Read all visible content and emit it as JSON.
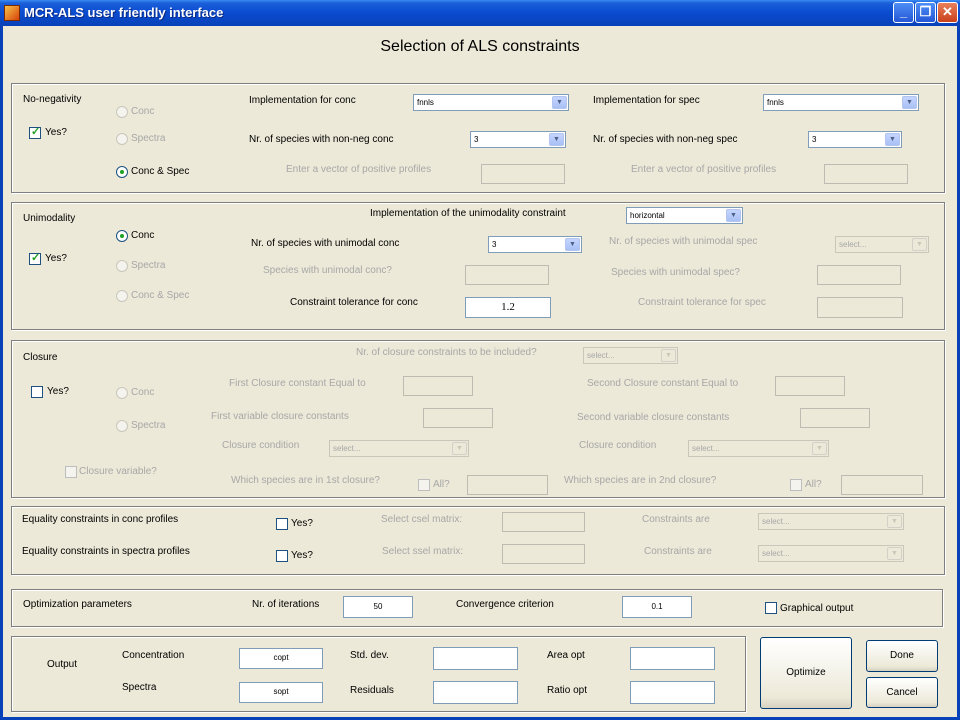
{
  "window": {
    "title": "MCR-ALS user friendly interface",
    "min_glyph": "_",
    "max_glyph": "❐",
    "close_glyph": "✕"
  },
  "page_title": "Selection of ALS constraints",
  "nonneg": {
    "title": "No-negativity",
    "yes": "Yes?",
    "opt_conc": "Conc",
    "opt_spectra": "Spectra",
    "opt_both": "Conc & Spec",
    "impl_conc_label": "Implementation for conc",
    "impl_conc_value": "fnnls",
    "impl_spec_label": "Implementation for spec",
    "impl_spec_value": "fnnls",
    "nr_conc_label": "Nr. of species with non-neg conc",
    "nr_conc_value": "3",
    "nr_spec_label": "Nr. of species with non-neg spec",
    "nr_spec_value": "3",
    "vec_conc_label": "Enter a vector of positive profiles",
    "vec_spec_label": "Enter a vector of positive profiles"
  },
  "unimod": {
    "title": "Unimodality",
    "yes": "Yes?",
    "opt_conc": "Conc",
    "opt_spectra": "Spectra",
    "opt_both": "Conc & Spec",
    "impl_label": "Implementation of the unimodality constraint",
    "impl_value": "horizontal",
    "nr_conc_label": "Nr. of species with unimodal conc",
    "nr_conc_value": "3",
    "nr_spec_label": "Nr. of species with unimodal spec",
    "nr_spec_value": "select...",
    "sp_conc_label": "Species with unimodal conc?",
    "sp_spec_label": "Species with unimodal spec?",
    "tol_conc_label": "Constraint tolerance for conc",
    "tol_conc_value": "1.2",
    "tol_spec_label": "Constraint tolerance for spec"
  },
  "closure": {
    "title": "Closure",
    "yes": "Yes?",
    "opt_conc": "Conc",
    "opt_spectra": "Spectra",
    "nr_label": "Nr. of closure constraints to be included?",
    "nr_value": "select...",
    "first_eq_label": "First Closure constant Equal to",
    "second_eq_label": "Second Closure constant Equal to",
    "first_var_label": "First variable closure constants",
    "second_var_label": "Second variable closure constants",
    "cond1_label": "Closure condition",
    "cond1_value": "select...",
    "cond2_label": "Closure condition",
    "cond2_value": "select...",
    "variable_label": "Closure variable?",
    "which1_label": "Which species are in 1st closure?",
    "which2_label": "Which species are in 2nd closure?",
    "all1": "All?",
    "all2": "All?"
  },
  "equality": {
    "conc_label": "Equality constraints in conc profiles",
    "spec_label": "Equality constraints in spectra profiles",
    "yes1": "Yes?",
    "yes2": "Yes?",
    "csel_label": "Select csel matrix:",
    "ssel_label": "Select ssel matrix:",
    "are1_label": "Constraints are",
    "are1_value": "select...",
    "are2_label": "Constraints are",
    "are2_value": "select..."
  },
  "optim": {
    "title": "Optimization parameters",
    "iter_label": "Nr. of iterations",
    "iter_value": "50",
    "conv_label": "Convergence criterion",
    "conv_value": "0.1",
    "graph_label": "Graphical output"
  },
  "output": {
    "title": "Output",
    "conc_label": "Concentration",
    "conc_value": "copt",
    "spec_label": "Spectra",
    "spec_value": "sopt",
    "std_label": "Std. dev.",
    "res_label": "Residuals",
    "area_label": "Area opt",
    "ratio_label": "Ratio opt"
  },
  "buttons": {
    "optimize": "Optimize",
    "done": "Done",
    "cancel": "Cancel"
  }
}
